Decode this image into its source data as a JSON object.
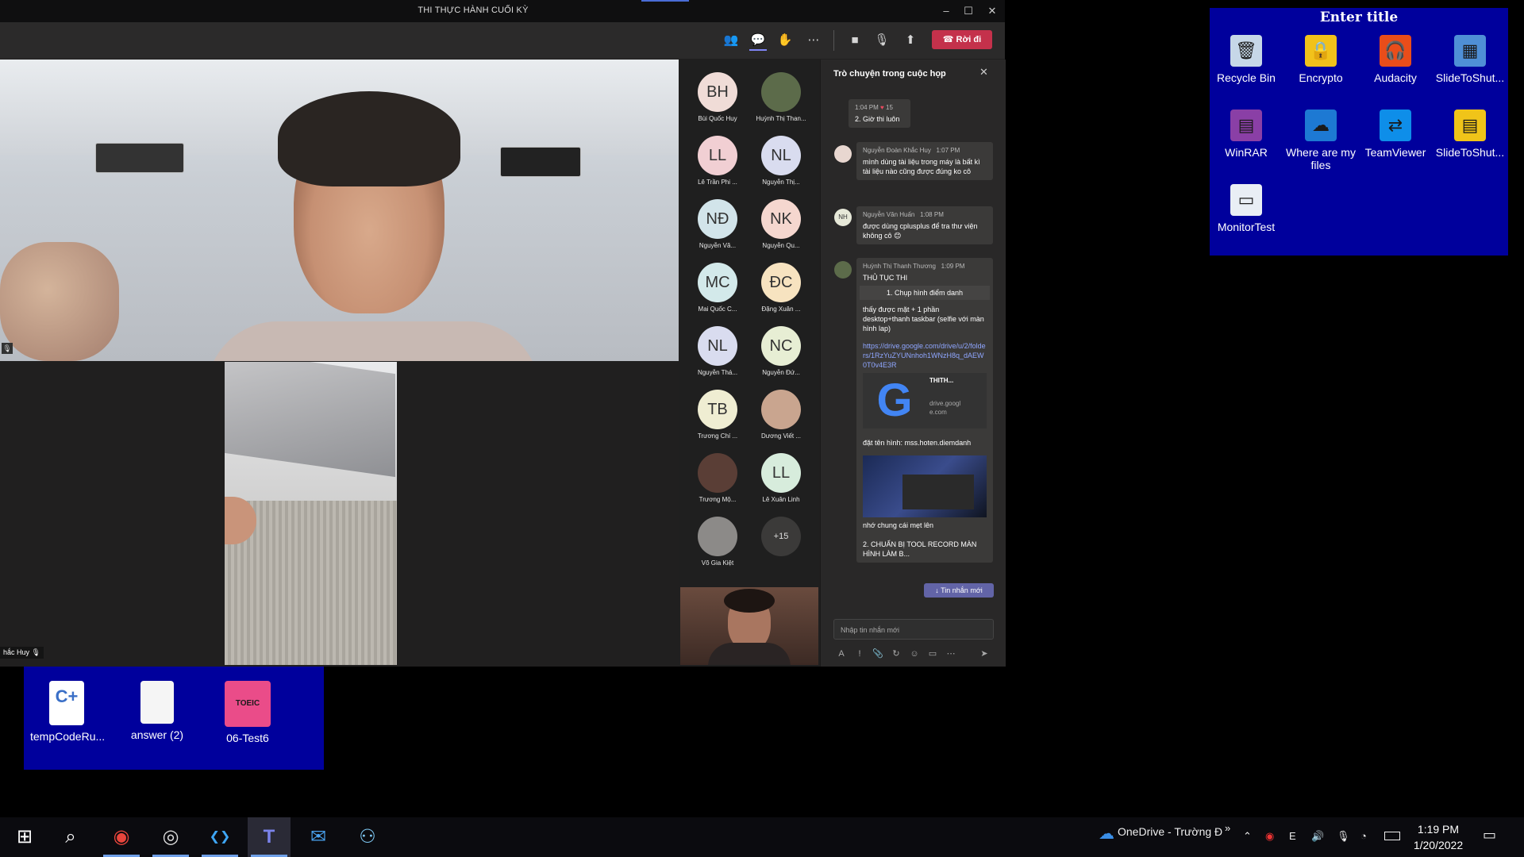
{
  "window": {
    "title": "THI THỰC HÀNH CUỐI KỲ",
    "buttons": {
      "minimize": "–",
      "maximize": "☐",
      "close": "✕"
    }
  },
  "toolbar": {
    "icons": [
      "people-icon",
      "chat-icon",
      "reactions-icon",
      "more-icon",
      "camera-icon",
      "mic-off-icon",
      "share-icon"
    ],
    "leave_label": "Rời đi"
  },
  "main_video": {
    "label": ""
  },
  "second_video": {
    "label": "hắc Huy"
  },
  "participants": [
    {
      "initials": "BH",
      "name": "Bùi Quốc Huy",
      "color": "#f0dcd7"
    },
    {
      "initials": "",
      "name": "Huỳnh Thị Than...",
      "color": "#5c6b4a"
    },
    {
      "initials": "LL",
      "name": "Lê Trần Phi ...",
      "color": "#f1cfd3"
    },
    {
      "initials": "NL",
      "name": "Nguyễn Thị...",
      "color": "#d9dcef"
    },
    {
      "initials": "NĐ",
      "name": "Nguyễn Vă...",
      "color": "#d2e4ea"
    },
    {
      "initials": "NK",
      "name": "Nguyễn Qu...",
      "color": "#f5d7cf"
    },
    {
      "initials": "MC",
      "name": "Mai Quốc C...",
      "color": "#d3e9ea"
    },
    {
      "initials": "ĐC",
      "name": "Đặng Xuân ...",
      "color": "#f7e3c0"
    },
    {
      "initials": "NL",
      "name": "Nguyễn Thá...",
      "color": "#d9dcef"
    },
    {
      "initials": "NC",
      "name": "Nguyễn Đứ...",
      "color": "#e7eed4"
    },
    {
      "initials": "TB",
      "name": "Trương Chí ...",
      "color": "#efedd2"
    },
    {
      "initials": "",
      "name": "Dương Viết ...",
      "color": "#c9a58f"
    },
    {
      "initials": "",
      "name": "Trương Mộ...",
      "color": "#5a3e36"
    },
    {
      "initials": "LL",
      "name": "Lê Xuân Linh",
      "color": "#d7ecdc"
    },
    {
      "initials": "",
      "name": "Võ Gia Kiệt",
      "color": "#8c8a88"
    },
    {
      "initials": "+15",
      "name": "",
      "color": "#3b3a39"
    }
  ],
  "chat": {
    "title": "Trò chuyện trong cuộc họp",
    "messages": [
      {
        "time": "1:04 PM",
        "reaction": "15",
        "text": "2. Giờ thi luôn"
      },
      {
        "author": "Nguyễn Đoàn Khắc Huy",
        "time": "1:07 PM",
        "text": "mình dùng tài liệu trong máy là bất kì tài liệu nào cũng được đúng ko cô"
      },
      {
        "author": "Nguyễn Văn Huấn",
        "time": "1:08 PM",
        "initials": "NH",
        "text": "được dùng cplusplus để tra thư viện không cô 😊"
      },
      {
        "author": "Huỳnh Thị Thanh Thương",
        "time": "1:09 PM",
        "text": "THỦ TỤC THI",
        "step1": "1. Chụp hình điểm danh",
        "body": "thấy được mặt + 1 phần desktop+thanh taskbar (selfie với màn hình lap)",
        "link": "https://drive.google.com/drive/u/2/folders/1RzYuZYUNnhoh1WNzH8q_dAEW0T0v4E3R",
        "card_title": "THITH...",
        "card_domain": "drive.google.com",
        "naming": "đặt tên hình: mss.hoten.diemdanh",
        "after_image": "nhớ chung cái mẹt lên",
        "step2": "2. CHUẨN BỊ TOOL RECORD MÀN HÌNH LÀM B..."
      }
    ],
    "new_messages": "Tin nhắn mới",
    "compose_placeholder": "Nhập tin nhắn mới"
  },
  "fence_top": {
    "title": "Enter title",
    "icons": [
      {
        "label": "Recycle Bin",
        "icon": "recycle-bin-icon",
        "glyph": "🗑",
        "bg": "#c6d7e8"
      },
      {
        "label": "Encrypto",
        "icon": "encrypto-icon",
        "glyph": "🔒",
        "bg": "#f2c21b"
      },
      {
        "label": "Audacity",
        "icon": "audacity-icon",
        "glyph": "🎧",
        "bg": "#e94d1a"
      },
      {
        "label": "SlideToShut...",
        "icon": "slidetoshut-icon",
        "glyph": "▦",
        "bg": "#4f8fd6"
      },
      {
        "label": "WinRAR",
        "icon": "winrar-icon",
        "glyph": "▤",
        "bg": "#8a3fa6"
      },
      {
        "label": "Where are my files",
        "icon": "onedrive-icon",
        "glyph": "☁",
        "bg": "#1d79d3"
      },
      {
        "label": "TeamViewer",
        "icon": "teamviewer-icon",
        "glyph": "⇄",
        "bg": "#0e8ee9"
      },
      {
        "label": "SlideToShut...",
        "icon": "slidetoshut-file-icon",
        "glyph": "▤",
        "bg": "#f0c419"
      },
      {
        "label": "MonitorTest",
        "icon": "monitortest-icon",
        "glyph": "▭",
        "bg": "#e9eef5"
      }
    ]
  },
  "fence_bottom": {
    "icons": [
      {
        "label": "tempCodeRu...",
        "icon": "cpp-file-icon",
        "glyph": "C+",
        "bg": "#ffffff"
      },
      {
        "label": "answer (2)",
        "icon": "text-file-icon",
        "glyph": "",
        "bg": "#f5f5f5"
      },
      {
        "label": "06-Test6",
        "icon": "toeic-book-icon",
        "glyph": "TOEIC",
        "bg": "#ea4c89"
      }
    ]
  },
  "taskbar": {
    "apps": [
      {
        "name": "start-icon",
        "glyph": "⊞",
        "color": "#ffffff"
      },
      {
        "name": "search-icon",
        "glyph": "⌕",
        "color": "#ffffff"
      },
      {
        "name": "chrome-icon",
        "glyph": "◉",
        "color": "#e8453c"
      },
      {
        "name": "obs-icon",
        "glyph": "◎",
        "color": "#dddddd"
      },
      {
        "name": "vscode-icon",
        "glyph": "❮❯",
        "color": "#3ea6f5"
      },
      {
        "name": "teams-icon",
        "glyph": "T",
        "color": "#7b83eb"
      },
      {
        "name": "mail-icon",
        "glyph": "✉",
        "color": "#4aa3f0"
      },
      {
        "name": "app-icon",
        "glyph": "⚇",
        "color": "#7ec7f2"
      }
    ],
    "onedrive_label": "OneDrive - Trường Đ",
    "time": "1:19 PM",
    "date": "1/20/2022"
  }
}
